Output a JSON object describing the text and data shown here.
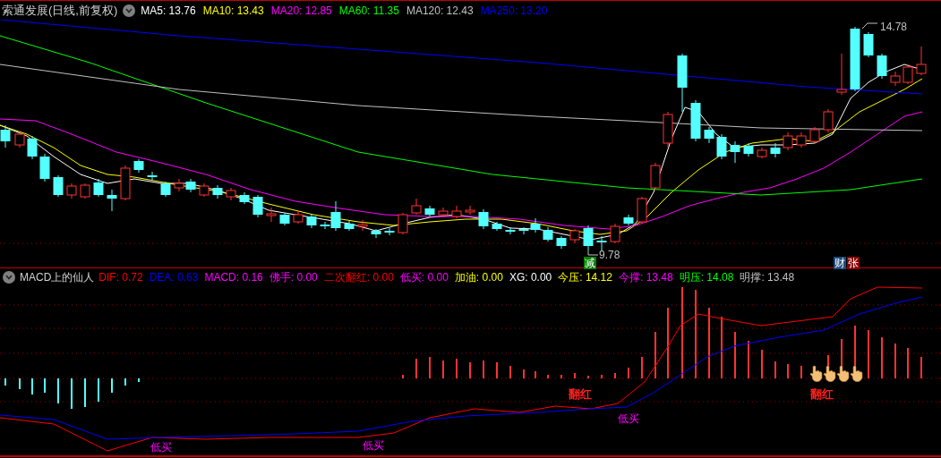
{
  "price_panel": {
    "title": "索通发展(日线,前复权)",
    "indicators": [
      {
        "label": "MA5:",
        "value": "13.76",
        "color": "#ffffff"
      },
      {
        "label": "MA10:",
        "value": "13.43",
        "color": "#ffff00"
      },
      {
        "label": "MA20:",
        "value": "12.85",
        "color": "#ff00ff"
      },
      {
        "label": "MA60:",
        "value": "11.35",
        "color": "#00ff00"
      },
      {
        "label": "MA120:",
        "value": "12.43",
        "color": "#c0c0c0"
      },
      {
        "label": "MA250:",
        "value": "13.20",
        "color": "#0000ff"
      }
    ],
    "high_label": "14.78",
    "low_label": "9.78",
    "badges": [
      {
        "text": "减",
        "color": "#008000"
      },
      {
        "text": "财",
        "color": "#1e4a7a"
      },
      {
        "text": "张",
        "color": "#8b0000"
      }
    ]
  },
  "macd_panel": {
    "title": "MACD上的仙人",
    "indicators": [
      {
        "label": "DIF:",
        "value": "0.72",
        "color": "#ff0000"
      },
      {
        "label": "DEA:",
        "value": "0.63",
        "color": "#0000ff"
      },
      {
        "label": "MACD:",
        "value": "0.16",
        "color": "#ff00ff"
      },
      {
        "label": "佛手:",
        "value": "0.00",
        "color": "#ff00ff"
      },
      {
        "label": "二次翻红:",
        "value": "0.00",
        "color": "#ff0000"
      },
      {
        "label": "低买:",
        "value": "0.00",
        "color": "#ff00ff"
      },
      {
        "label": "加油:",
        "value": "0.00",
        "color": "#ffff00"
      },
      {
        "label": "XG:",
        "value": "0.00",
        "color": "#ffffff"
      },
      {
        "label": "今压:",
        "value": "14.12",
        "color": "#ffff00"
      },
      {
        "label": "今撑:",
        "value": "13.48",
        "color": "#ff00ff"
      },
      {
        "label": "明压:",
        "value": "14.08",
        "color": "#00ff00"
      },
      {
        "label": "明撑:",
        "value": "13.48",
        "color": "#c0c0c0"
      }
    ],
    "signals": [
      {
        "text": "低买",
        "kind": "buy"
      },
      {
        "text": "低买",
        "kind": "buy"
      },
      {
        "text": "翻红",
        "kind": "flip"
      },
      {
        "text": "低买",
        "kind": "buy"
      },
      {
        "text": "翻红",
        "kind": "flip"
      }
    ]
  }
}
